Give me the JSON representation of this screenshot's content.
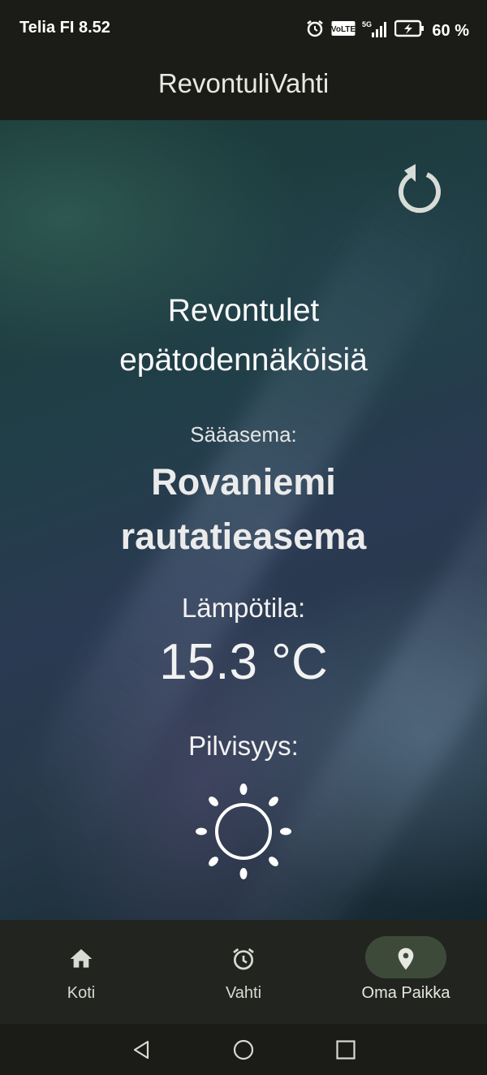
{
  "status_bar": {
    "carrier_time": "Telia FI 8.52",
    "battery": "60 %",
    "icons": [
      "alarm-icon",
      "volte-icon",
      "5g-signal-icon",
      "battery-charging-icon"
    ],
    "volte_label": "VoLTE",
    "network_label": "5G"
  },
  "app_bar": {
    "title": "RevontuliVahti"
  },
  "main": {
    "refresh_icon": "refresh-icon",
    "headline": "Revontulet epätodennäköisiä",
    "station_label": "Sääasema:",
    "station_name": "Rovaniemi rautatieasema",
    "temperature_label": "Lämpötila:",
    "temperature_value": "15.3 °C",
    "cloudiness_label": "Pilvisyys:",
    "cloudiness_icon": "sun-icon"
  },
  "bottom_nav": {
    "items": [
      {
        "label": "Koti",
        "icon": "home-icon",
        "active": false
      },
      {
        "label": "Vahti",
        "icon": "alarm-clock-icon",
        "active": false
      },
      {
        "label": "Oma Paikka",
        "icon": "location-pin-icon",
        "active": true
      }
    ]
  },
  "system_nav": {
    "icons": [
      "back-icon",
      "home-circle-icon",
      "recents-icon"
    ]
  },
  "colors": {
    "bar_background": "#1b1c18",
    "nav_background": "#22241f",
    "active_pill": "#3d4a3a"
  }
}
